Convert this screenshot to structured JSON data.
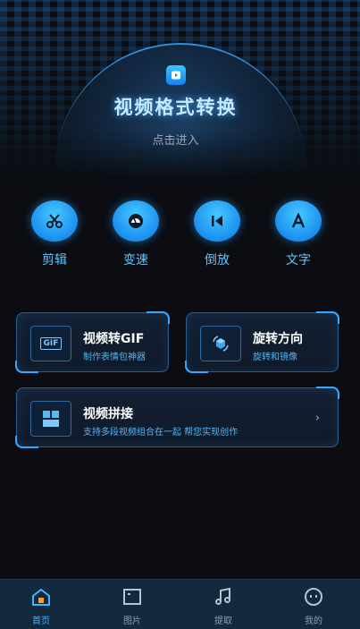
{
  "header": {
    "logo_icon": "video-play-icon",
    "title": "视频格式转换",
    "subtitle": "点击进入"
  },
  "tools": [
    {
      "label": "剪辑",
      "icon": "scissors-icon"
    },
    {
      "label": "变速",
      "icon": "speedometer-icon"
    },
    {
      "label": "倒放",
      "icon": "skip-back-icon"
    },
    {
      "label": "文字",
      "icon": "letter-a-icon"
    }
  ],
  "cards": {
    "gif": {
      "title": "视频转GIF",
      "subtitle": "制作表情包神器",
      "icon_text": "GIF"
    },
    "rotate": {
      "title": "旋转方向",
      "subtitle": "旋转和镜像"
    },
    "splice": {
      "title": "视频拼接",
      "subtitle": "支持多段视频组合在一起 帮您实现创作",
      "chevron": "›"
    }
  },
  "tabs": [
    {
      "label": "首页",
      "icon": "home-icon",
      "active": true
    },
    {
      "label": "图片",
      "icon": "image-icon",
      "active": false
    },
    {
      "label": "提取",
      "icon": "music-note-icon",
      "active": false
    },
    {
      "label": "我的",
      "icon": "face-icon",
      "active": false
    }
  ],
  "colors": {
    "accent": "#3fb6ff",
    "background": "#0b0d12",
    "tabbar": "#13293d"
  }
}
